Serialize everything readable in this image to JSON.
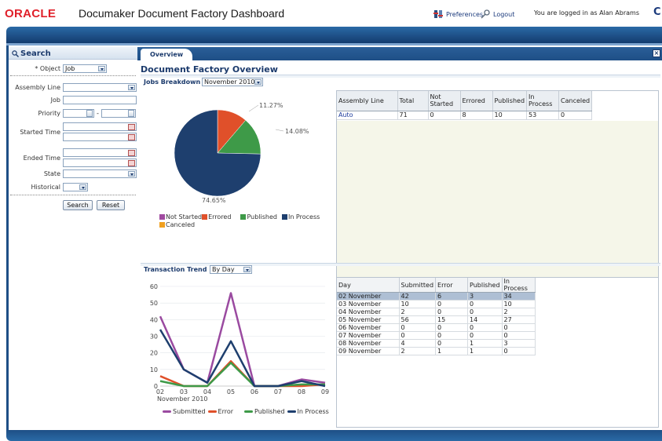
{
  "header": {
    "logo_text": "ORACLE",
    "title": "Documaker Document Factory Dashboard",
    "preferences": "Preferences",
    "logout": "Logout",
    "login_status": "You are logged in as Alan Abrams",
    "help_glyph": "C"
  },
  "search": {
    "title": "Search",
    "fields": {
      "object_label": "* Object",
      "object_value": "Job",
      "assembly_line_label": "Assembly Line",
      "job_label": "Job",
      "priority_label": "Priority",
      "priority_sep": "-",
      "started_time_label": "Started Time",
      "ended_time_label": "Ended Time",
      "state_label": "State",
      "historical_label": "Historical"
    },
    "search_button": "Search",
    "reset_button": "Reset"
  },
  "tabs": {
    "overview": "Overview"
  },
  "overview": {
    "page_title": "Document Factory Overview",
    "jobs_breakdown_label": "Jobs Breakdown",
    "jobs_breakdown_period": "November 2010",
    "assembly_table": {
      "headers": [
        "Assembly Line",
        "Total",
        "Not Started",
        "Errored",
        "Published",
        "In Process",
        "Canceled"
      ],
      "rows": [
        [
          "Auto",
          "71",
          "0",
          "8",
          "10",
          "53",
          "0"
        ]
      ]
    },
    "transaction_trend_label": "Transaction Trend",
    "transaction_trend_period": "By Day",
    "trend_table": {
      "headers": [
        "Day",
        "Submitted",
        "Error",
        "Published",
        "In Process"
      ],
      "rows": [
        [
          "02 November",
          "42",
          "6",
          "3",
          "34"
        ],
        [
          "03 November",
          "10",
          "0",
          "0",
          "10"
        ],
        [
          "04 November",
          "2",
          "0",
          "0",
          "2"
        ],
        [
          "05 November",
          "56",
          "15",
          "14",
          "27"
        ],
        [
          "06 November",
          "0",
          "0",
          "0",
          "0"
        ],
        [
          "07 November",
          "0",
          "0",
          "0",
          "0"
        ],
        [
          "08 November",
          "4",
          "0",
          "1",
          "3"
        ],
        [
          "09 November",
          "2",
          "1",
          "1",
          "0"
        ]
      ]
    }
  },
  "chart_data": [
    {
      "type": "pie",
      "labels": [
        "Not Started",
        "Errored",
        "Published",
        "In Process",
        "Canceled"
      ],
      "values": [
        0,
        11.27,
        14.08,
        74.65,
        0
      ],
      "data_labels": [
        "11.27%",
        "14.08%",
        "74.65%"
      ],
      "colors": [
        "#a04aa0",
        "#e0502a",
        "#3e9a48",
        "#1e3f6e",
        "#f0a020"
      ],
      "legend": "bottom"
    },
    {
      "type": "line",
      "x": [
        "02",
        "03",
        "04",
        "05",
        "06",
        "07",
        "08",
        "09"
      ],
      "xlabel": "November 2010",
      "ylim": [
        0,
        60
      ],
      "yticks": [
        0,
        10,
        20,
        30,
        40,
        50,
        60
      ],
      "series": [
        {
          "name": "Submitted",
          "values": [
            42,
            10,
            2,
            56,
            0,
            0,
            4,
            2
          ],
          "color": "#9a4aa0"
        },
        {
          "name": "Error",
          "values": [
            6,
            0,
            0,
            15,
            0,
            0,
            0,
            1
          ],
          "color": "#e0502a"
        },
        {
          "name": "Published",
          "values": [
            3,
            0,
            0,
            14,
            0,
            0,
            1,
            1
          ],
          "color": "#3e9a48"
        },
        {
          "name": "In Process",
          "values": [
            34,
            10,
            2,
            27,
            0,
            0,
            3,
            0
          ],
          "color": "#1e3f6e"
        }
      ],
      "legend": "bottom",
      "grid": true
    }
  ]
}
